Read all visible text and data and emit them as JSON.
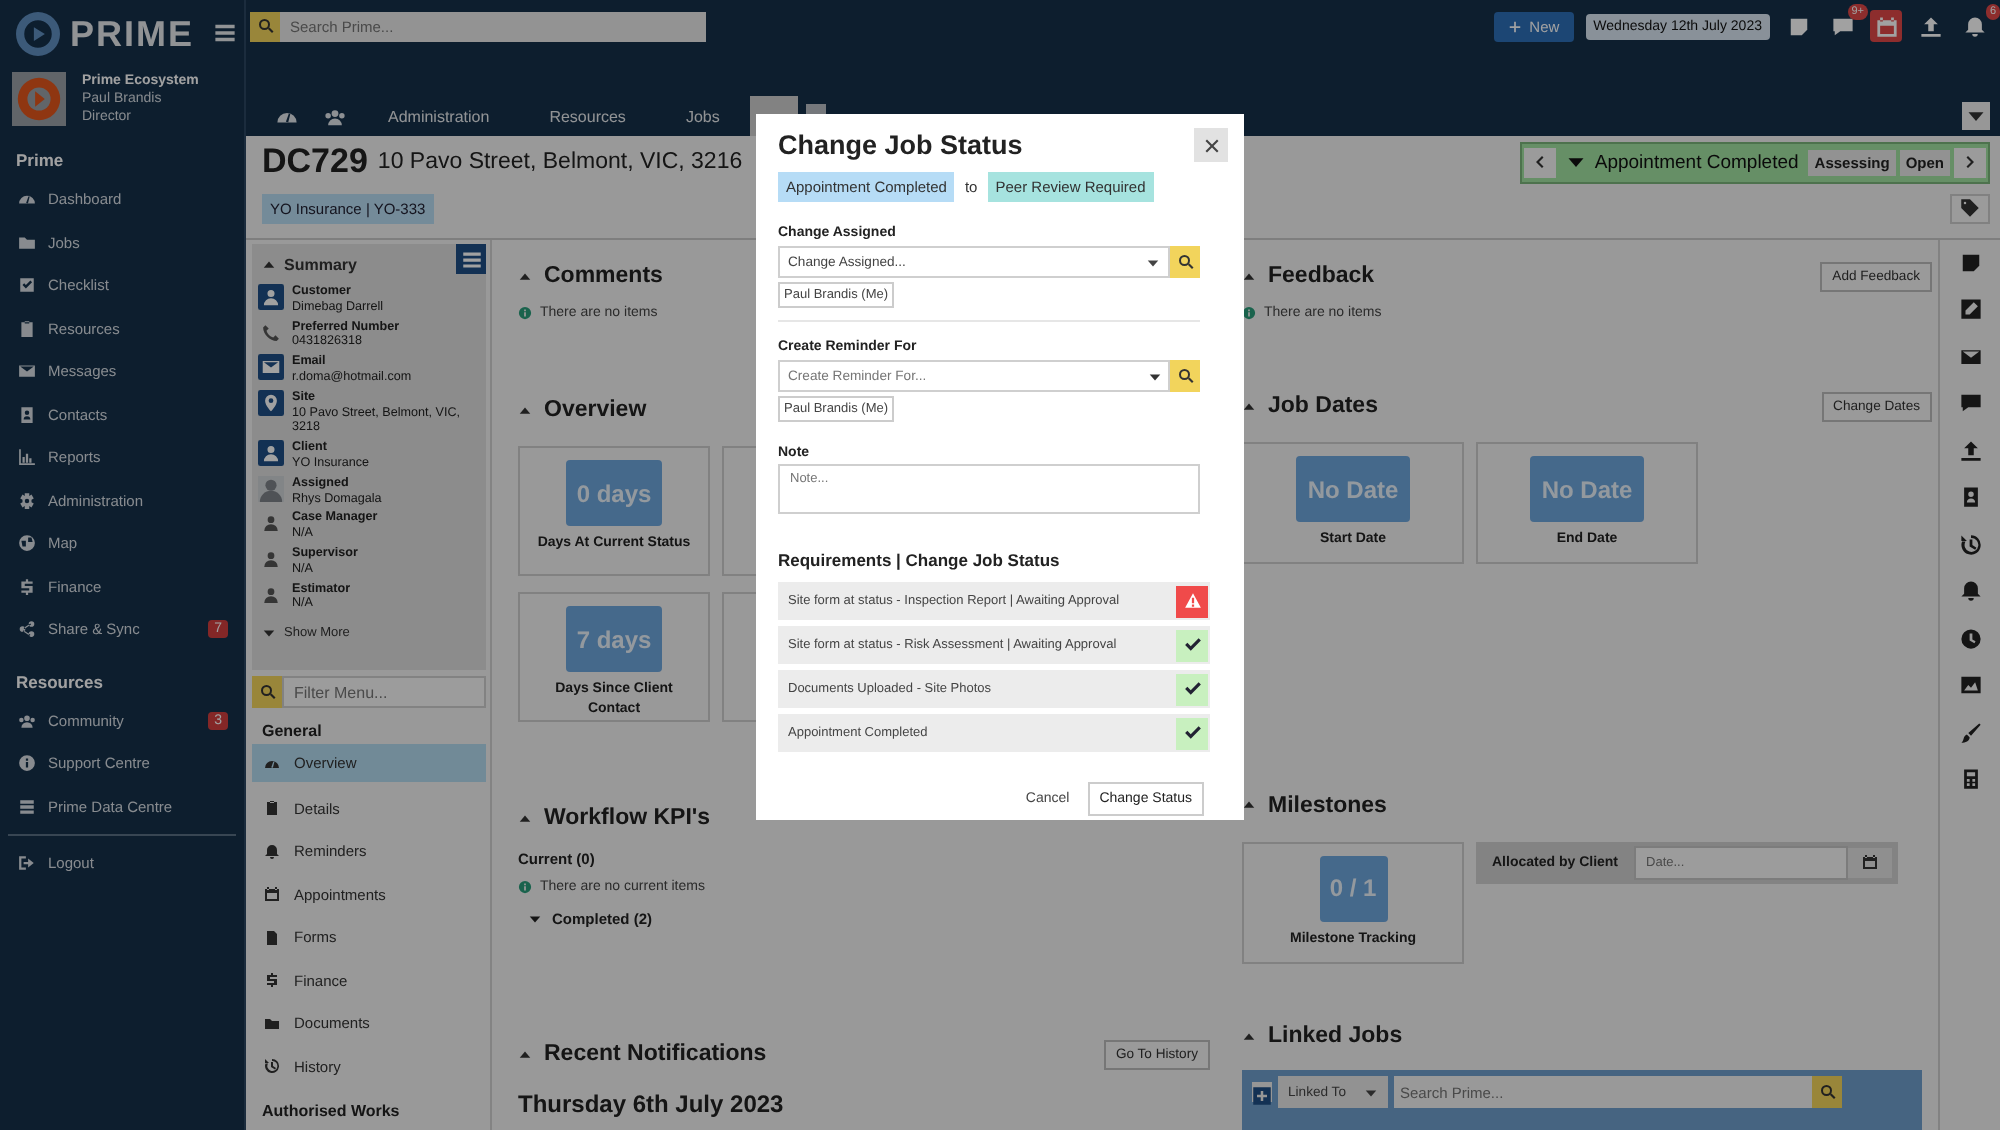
{
  "sidebar": {
    "brand": "PRIME",
    "org": "Prime Ecosystem",
    "user": "Paul Brandis",
    "role": "Director",
    "groups": [
      {
        "title": "Prime",
        "items": [
          {
            "label": "Dashboard"
          },
          {
            "label": "Jobs"
          },
          {
            "label": "Checklist"
          },
          {
            "label": "Resources"
          },
          {
            "label": "Messages"
          },
          {
            "label": "Contacts"
          },
          {
            "label": "Reports"
          },
          {
            "label": "Administration"
          },
          {
            "label": "Map"
          },
          {
            "label": "Finance"
          },
          {
            "label": "Share & Sync",
            "badge": "7"
          }
        ]
      },
      {
        "title": "Resources",
        "items": [
          {
            "label": "Community",
            "badge": "3"
          },
          {
            "label": "Support Centre"
          },
          {
            "label": "Prime Data Centre"
          }
        ]
      }
    ],
    "logout": "Logout"
  },
  "topbar": {
    "search": {
      "placeholder": "Search Prime..."
    },
    "new_button": "New",
    "date": "Wednesday 12th July 2023",
    "chat_badge": "9+",
    "bell_badge": "6",
    "tabs": [
      {
        "label": "Administration",
        "selected": false
      },
      {
        "label": "Resources",
        "selected": false
      },
      {
        "label": "Jobs",
        "selected": false
      },
      {
        "selected": true
      }
    ]
  },
  "job": {
    "number": "DC729",
    "address": "10 Pavo Street, Belmont, VIC, 3216",
    "tag": "YO Insurance | YO-333",
    "status": {
      "label": "Appointment Completed",
      "badges": [
        "Assessing",
        "Open"
      ]
    }
  },
  "summary": {
    "title": "Summary",
    "fields": [
      {
        "label": "Customer",
        "value": "Dimebag Darrell"
      },
      {
        "label": "Preferred Number",
        "value": "0431826318"
      },
      {
        "label": "Email",
        "value": "r.doma@hotmail.com"
      },
      {
        "label": "Site",
        "value": "10 Pavo Street, Belmont, VIC, 3218"
      },
      {
        "label": "Client",
        "value": "YO Insurance"
      },
      {
        "label": "Assigned",
        "value": "Rhys Domagala"
      },
      {
        "label": "Case Manager",
        "value": "N/A"
      },
      {
        "label": "Supervisor",
        "value": "N/A"
      },
      {
        "label": "Estimator",
        "value": "N/A"
      }
    ],
    "show_more": "Show More"
  },
  "menu": {
    "filter": {
      "placeholder": "Filter Menu..."
    },
    "heading": "General",
    "items": [
      {
        "label": "Overview",
        "selected": true
      },
      {
        "label": "Details",
        "selected": false
      },
      {
        "label": "Reminders",
        "selected": false
      },
      {
        "label": "Appointments",
        "selected": false
      },
      {
        "label": "Forms",
        "selected": false
      },
      {
        "label": "Finance",
        "selected": false
      },
      {
        "label": "Documents",
        "selected": false
      },
      {
        "label": "History",
        "selected": false
      }
    ],
    "footer_heading": "Authorised Works"
  },
  "comments": {
    "title": "Comments",
    "empty": "There are no items"
  },
  "overview": {
    "title": "Overview",
    "cards": [
      {
        "value": "0 days",
        "label": "Days At Current Status"
      },
      {
        "value": "7 days",
        "label": "Days Since Client Contact"
      }
    ]
  },
  "workflow": {
    "title": "Workflow KPI's",
    "current": "Current (0)",
    "empty": "There are no current items",
    "completed": "Completed (2)"
  },
  "notifications": {
    "title": "Recent Notifications",
    "button": "Go To History",
    "date": "Thursday 6th July 2023"
  },
  "feedback": {
    "title": "Feedback",
    "button": "Add Feedback",
    "empty": "There are no items"
  },
  "job_dates": {
    "title": "Job Dates",
    "button": "Change Dates",
    "cards": [
      {
        "value": "No Date",
        "label": "Start Date"
      },
      {
        "value": "No Date",
        "label": "End Date"
      }
    ]
  },
  "milestones": {
    "title": "Milestones",
    "card": {
      "value": "0 / 1",
      "label": "Milestone Tracking"
    },
    "allocated": {
      "label": "Allocated by Client",
      "placeholder": "Date..."
    }
  },
  "linked_jobs": {
    "title": "Linked Jobs",
    "select": "Linked To",
    "search": {
      "placeholder": "Search Prime..."
    }
  },
  "modal": {
    "title": "Change Job Status",
    "from": "Appointment Completed",
    "connector": "to",
    "to": "Peer Review Required",
    "assign": {
      "label": "Change Assigned",
      "value": "Change Assigned...",
      "chip": "Paul Brandis (Me)"
    },
    "reminder": {
      "label": "Create Reminder For",
      "placeholder": "Create Reminder For...",
      "chip": "Paul Brandis (Me)"
    },
    "note": {
      "label": "Note",
      "placeholder": "Note..."
    },
    "requirements_title": "Requirements | Change Job Status",
    "requirements": [
      {
        "label": "Site form at status - Inspection Report | Awaiting Approval",
        "met": false
      },
      {
        "label": "Site form at status - Risk Assessment | Awaiting Approval",
        "met": true
      },
      {
        "label": "Documents Uploaded - Site Photos",
        "met": true
      },
      {
        "label": "Appointment Completed",
        "met": true
      }
    ],
    "cancel": "Cancel",
    "submit": "Change Status"
  }
}
